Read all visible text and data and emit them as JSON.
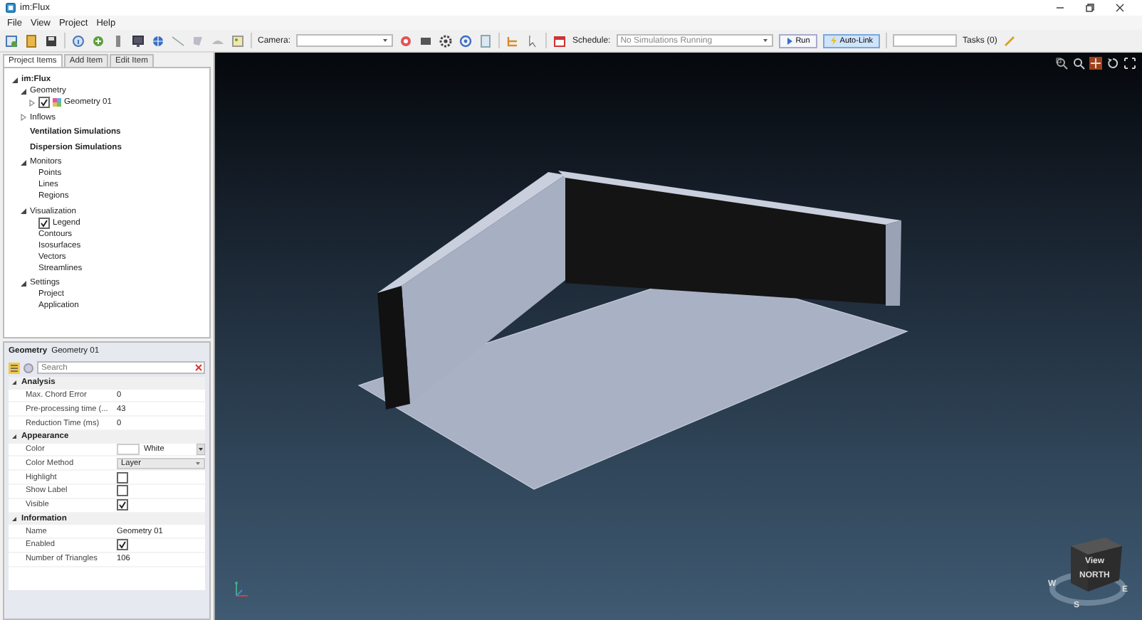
{
  "window": {
    "title": "im:Flux"
  },
  "menu": [
    "File",
    "View",
    "Project",
    "Help"
  ],
  "toolbar": {
    "camera_label": "Camera:",
    "schedule_label": "Schedule:",
    "schedule_status": "No Simulations Running",
    "run": "Run",
    "auto_link": {
      "label": "Auto-Link",
      "on": true
    },
    "tasks": "Tasks (0)"
  },
  "tabs": [
    {
      "label": "Project Items",
      "selected": true
    },
    {
      "label": "Add Item",
      "selected": false
    },
    {
      "label": "Edit Item",
      "selected": false
    }
  ],
  "tree": [
    {
      "label": "im:Flux",
      "bold": true,
      "expanded": true,
      "children": [
        {
          "label": "Geometry",
          "expanded": true,
          "children": [
            {
              "label": "Geometry 01",
              "expanded": false,
              "checked": true,
              "swatch": true
            }
          ]
        },
        {
          "label": "Inflows",
          "expanded": false
        },
        {
          "label": "Ventilation Simulations",
          "bold": true
        },
        {
          "label": "Dispersion Simulations",
          "bold": true
        },
        {
          "label": "Monitors",
          "expanded": true,
          "children": [
            {
              "label": "Points"
            },
            {
              "label": "Lines"
            },
            {
              "label": "Regions"
            }
          ]
        },
        {
          "label": "Visualization",
          "expanded": true,
          "children": [
            {
              "label": "Legend",
              "checked": true
            },
            {
              "label": "Contours"
            },
            {
              "label": "Isosurfaces"
            },
            {
              "label": "Vectors"
            },
            {
              "label": "Streamlines"
            }
          ]
        },
        {
          "label": "Settings",
          "expanded": true,
          "children": [
            {
              "label": "Project"
            },
            {
              "label": "Application"
            }
          ]
        }
      ]
    }
  ],
  "properties": {
    "type": "Geometry",
    "name": "Geometry 01",
    "search": {
      "placeholder": "Search"
    },
    "categories": [
      {
        "label": "Analysis",
        "expanded": true,
        "rows": [
          {
            "kind": "text",
            "name": "Max. Chord Error",
            "value": "0"
          },
          {
            "kind": "text",
            "name": "Pre-processing time (...",
            "value": "43"
          },
          {
            "kind": "text",
            "name": "Reduction Time (ms)",
            "value": "0"
          }
        ]
      },
      {
        "label": "Appearance",
        "expanded": true,
        "rows": [
          {
            "kind": "color",
            "name": "Color",
            "value": "White",
            "color": "#ffffff"
          },
          {
            "kind": "select",
            "name": "Color Method",
            "value": "Layer"
          },
          {
            "kind": "check",
            "name": "Highlight",
            "checked": false
          },
          {
            "kind": "check",
            "name": "Show Label",
            "checked": false
          },
          {
            "kind": "check",
            "name": "Visible",
            "checked": true
          }
        ]
      },
      {
        "label": "Information",
        "expanded": true,
        "rows": [
          {
            "kind": "text",
            "name": "Name",
            "value": "Geometry 01"
          },
          {
            "kind": "check",
            "name": "Enabled",
            "checked": true
          },
          {
            "kind": "text",
            "name": "Number of Triangles",
            "value": "106"
          }
        ]
      }
    ]
  },
  "nav_cube": {
    "face_top": "View",
    "face_bottom": "NORTH",
    "compass": [
      "W",
      "E",
      "S"
    ]
  }
}
